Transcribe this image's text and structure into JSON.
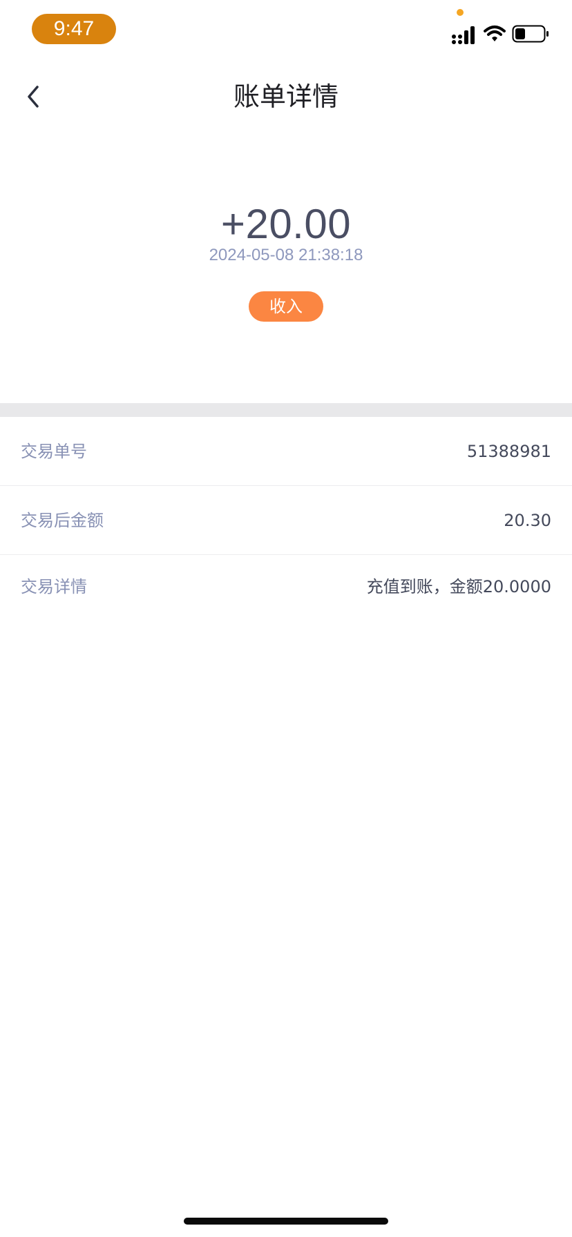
{
  "status_bar": {
    "time": "9:47",
    "signal_icon": "cellular-signal-icon",
    "wifi_icon": "wifi-icon",
    "battery_icon": "battery-icon",
    "battery_level": 0.35,
    "time_pill_color": "#d9830e",
    "privacy_dot_color": "#f5a623"
  },
  "nav": {
    "title": "账单详情",
    "back_icon": "chevron-left-icon"
  },
  "summary": {
    "amount": "+20.00",
    "timestamp": "2024-05-08 21:38:18",
    "badge": "收入",
    "badge_color": "#fb8642"
  },
  "details": [
    {
      "label": "交易单号",
      "value": "51388981"
    },
    {
      "label": "交易后金额",
      "value": "20.30"
    },
    {
      "label": "交易详情",
      "value": "充值到账，金额20.0000"
    }
  ]
}
